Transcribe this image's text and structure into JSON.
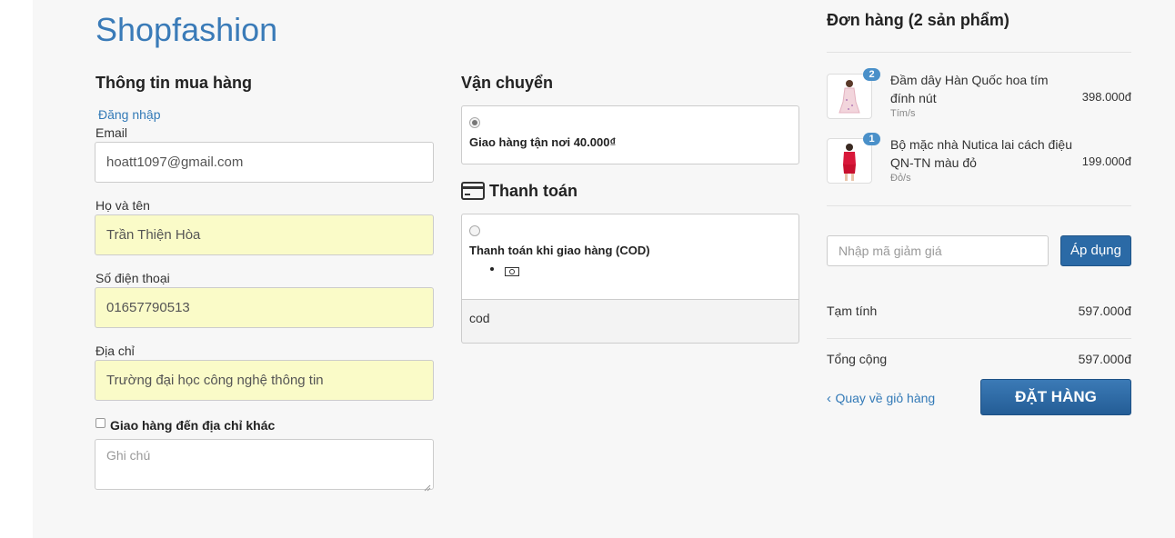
{
  "brand": "Shopfashion",
  "customer": {
    "title": "Thông tin mua hàng",
    "login_link": "Đăng nhập",
    "email_label": "Email",
    "email_value": "hoatt1097@gmail.com",
    "name_label": "Họ và tên",
    "name_value": "Trần Thiện Hòa",
    "phone_label": "Số điện thoại",
    "phone_value": "01657790513",
    "address_label": "Địa chỉ",
    "address_value": "Trường đại học công nghệ thông tin",
    "ship_other_label": "Giao hàng đến địa chỉ khác",
    "note_placeholder": "Ghi chú"
  },
  "shipping": {
    "title": "Vận chuyển",
    "option_label": "Giao hàng tận nơi 40.000₫"
  },
  "payment": {
    "title": "Thanh toán",
    "option_label": "Thanh toán khi giao hàng (COD)",
    "method_description": "cod"
  },
  "order": {
    "title": "Đơn hàng (2 sản phẩm)",
    "items": [
      {
        "name": "Đầm dây Hàn Quốc hoa tím đính nút",
        "variant": "Tím/s",
        "qty": "2",
        "price": "398.000đ"
      },
      {
        "name": "Bộ mặc nhà Nutica lai cách điệu QN-TN màu đỏ",
        "variant": "Đỏ/s",
        "qty": "1",
        "price": "199.000đ"
      }
    ],
    "discount_placeholder": "Nhập mã giảm giá",
    "apply_label": "Áp dụng",
    "subtotal_label": "Tạm tính",
    "subtotal_value": "597.000đ",
    "total_label": "Tổng cộng",
    "total_value": "597.000đ",
    "back_label": "Quay về giỏ hàng",
    "place_order_label": "ĐẶT HÀNG"
  },
  "icons": {
    "card": "credit-card-icon",
    "money": "money-icon",
    "chevron": "chevron-left-icon"
  },
  "colors": {
    "brand": "#3a7bb8",
    "filled_input": "#fafbc8",
    "button": "#2b6aa6"
  }
}
